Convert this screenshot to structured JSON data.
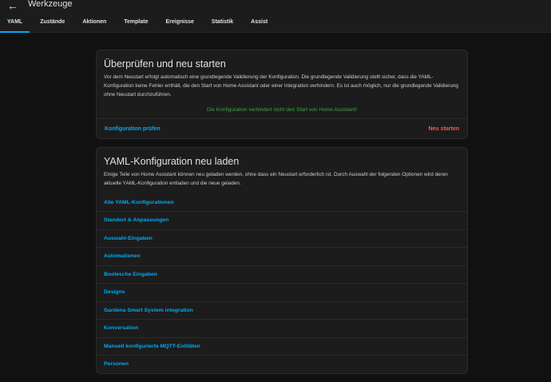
{
  "header": {
    "title": "Werkzeuge",
    "tabs": [
      "YAML",
      "Zustände",
      "Aktionen",
      "Template",
      "Ereignisse",
      "Statistik",
      "Assist"
    ]
  },
  "check_card": {
    "title": "Überprüfen und neu starten",
    "description": "Vor dem Neustart erfolgt automatisch eine grundlegende Validierung der Konfiguration. Die grundlegende Validierung stellt sicher, dass die YAML-Konfiguration keine Fehler enthält, die den Start von Home Assistant oder einer Integration verhindern. Es ist auch möglich, nur die grundlegende Validierung ohne Neustart durchzuführen.",
    "status_message": "Die Konfiguration verhindert nicht den Start von Home Assistant!",
    "check_label": "Konfiguration prüfen",
    "restart_label": "Neu starten"
  },
  "reload_card": {
    "title": "YAML-Konfiguration neu laden",
    "description": "Einige Teile von Home Assistant können neu geladen werden, ohne dass ein Neustart erforderlich ist. Durch Auswahl der folgenden Optionen wird deren aktuelle YAML-Konfiguration entladen und die neue geladen.",
    "items": [
      "Alle YAML-Konfigurationen",
      "Standort & Anpassungen",
      "Auswahl-Eingaben",
      "Automationen",
      "Boolesche Eingaben",
      "Designs",
      "Gardena Smart System integration",
      "Konversation",
      "Manuell konfigurierte MQTT-Entitäten",
      "Personen"
    ]
  },
  "colors": {
    "accent": "#03a9f4",
    "success": "#43a047",
    "danger": "#f35b50",
    "background": "#111111",
    "card": "#1c1c1c"
  }
}
